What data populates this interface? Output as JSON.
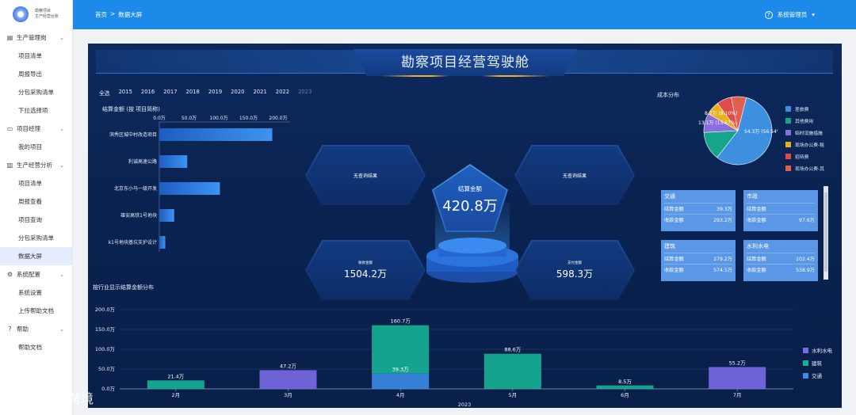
{
  "app": {
    "logo_line1": "勘察项目",
    "logo_line2": "生产经营台账"
  },
  "topbar": {
    "crumb_home": "首页",
    "crumb_sep": ">",
    "crumb_current": "数据大屏",
    "user_name": "系统管理员",
    "user_caret": "▾"
  },
  "sidebar": {
    "groups": [
      {
        "label": "生产管理岗",
        "icon": "building-icon",
        "items": [
          "项目清单",
          "周报导出",
          "分包采购清单",
          "下拉选择项"
        ]
      },
      {
        "label": "项目经理",
        "icon": "document-icon",
        "items": [
          "我的项目"
        ]
      },
      {
        "label": "生产经营分析",
        "icon": "chart-icon",
        "items": [
          "项目清单",
          "周报查看",
          "项目查询",
          "分包采购清单",
          "数据大屏"
        ]
      },
      {
        "label": "系统配置",
        "icon": "gear-icon",
        "items": [
          "系统设置",
          "上传帮助文档"
        ]
      },
      {
        "label": "帮助",
        "icon": "help-icon",
        "items": [
          "帮助文档"
        ]
      }
    ],
    "active": "数据大屏"
  },
  "dashboard": {
    "title": "勘察项目经营驾驶舱",
    "years": [
      "全选",
      "2015",
      "2016",
      "2017",
      "2018",
      "2019",
      "2020",
      "2021",
      "2022",
      "2023"
    ],
    "selected_year": "2023",
    "hex_top_left": "无查询结果",
    "hex_top_right": "无查询结果",
    "center_caption": "结算金额",
    "center_value": "420.8万",
    "hex_bottom_left_caption": "收款金额",
    "hex_bottom_left_value": "1504.2万",
    "hex_bottom_right_caption": "支付金额",
    "hex_bottom_right_value": "598.3万",
    "cost_title": "成本分布",
    "cost_legend": [
      {
        "label": "差旅费",
        "color": "#3d8fe0"
      },
      {
        "label": "其他费用",
        "color": "#16a58a"
      },
      {
        "label": "临时设施措施",
        "color": "#8a6de0"
      },
      {
        "label": "现场办公费-租",
        "color": "#e8b020"
      },
      {
        "label": "招待费",
        "color": "#e04b48"
      },
      {
        "label": "现场办公费-其",
        "color": "#e06050"
      }
    ],
    "cost_tables": [
      {
        "name": "交通",
        "settle_label": "结算金额",
        "settle": "39.3万",
        "collect_label": "收款金额",
        "collect": "293.2万"
      },
      {
        "name": "市政",
        "settle_label": "结算金额",
        "settle": "",
        "collect_label": "收款金额",
        "collect": "97.6万"
      },
      {
        "name": "建筑",
        "settle_label": "结算金额",
        "settle": "279.2万",
        "collect_label": "收款金额",
        "collect": "574.5万"
      },
      {
        "name": "水利水电",
        "settle_label": "结算金额",
        "settle": "102.4万",
        "collect_label": "收款金额",
        "collect": "538.9万"
      }
    ],
    "industry_title": "按行业显示结算金额分布"
  },
  "watermark": {
    "text": "大数跨境"
  },
  "chart_data": [
    {
      "type": "bar",
      "orientation": "horizontal",
      "title": "结算金额 (按 项目简称)",
      "categories": [
        "滨秀区城中村改造项目",
        "利诚高速公路",
        "北京东小马一级开发",
        "雄安高铁1号地块",
        "k1号地块基坑支护设计"
      ],
      "values": [
        190,
        47,
        102,
        25,
        10
      ],
      "ticks": [
        "0.0万",
        "50.0万",
        "100.0万",
        "150.0万",
        "200.0万"
      ],
      "xlim": [
        0,
        200
      ]
    },
    {
      "type": "pie",
      "title": "成本分布",
      "slices": [
        {
          "label": "差旅费",
          "value": 56.54,
          "text": "54.3万 (56.54%)",
          "color": "#3d8fe0"
        },
        {
          "label": "其他费用",
          "value": 13.67,
          "text": "13.1万 (13.67%)",
          "color": "#16a58a"
        },
        {
          "label": "临时设施措施",
          "value": 9.1,
          "text": "8.7万 (9.10%)",
          "color": "#8a6de0"
        },
        {
          "label": "现场办公费-租",
          "value": 6.5,
          "text": "",
          "color": "#e8b020"
        },
        {
          "label": "招待费",
          "value": 7.1,
          "text": "",
          "color": "#e04b48"
        },
        {
          "label": "现场办公费-其",
          "value": 7.09,
          "text": "",
          "color": "#e06050"
        }
      ]
    },
    {
      "type": "bar",
      "stacked": true,
      "title": "按行业显示结算金额分布",
      "categories": [
        "2月",
        "3月",
        "4月",
        "5月",
        "6月",
        "7月"
      ],
      "xlabel": "2023",
      "yticks": [
        "0.0万",
        "50.0万",
        "100.0万",
        "150.0万",
        "200.0万"
      ],
      "ylim": [
        0,
        200
      ],
      "series": [
        {
          "name": "交通",
          "color": "#3c8ce6",
          "values": [
            0,
            0,
            39.3,
            0,
            0,
            0
          ]
        },
        {
          "name": "建筑",
          "color": "#16b296",
          "values": [
            21.4,
            0,
            121.4,
            88.6,
            8.5,
            0
          ]
        },
        {
          "name": "水利水电",
          "color": "#7a6ae6",
          "values": [
            0,
            47.2,
            0,
            0,
            0,
            55.2
          ]
        }
      ],
      "bar_labels": [
        {
          "category": "2月",
          "text": "21.4万",
          "series": "建筑"
        },
        {
          "category": "3月",
          "text": "47.2万",
          "series": "水利水电"
        },
        {
          "category": "4月",
          "text": "160.7万",
          "series": "建筑"
        },
        {
          "category": "4月",
          "text": "39.3万",
          "series": "交通"
        },
        {
          "category": "5月",
          "text": "88.6万",
          "series": "建筑"
        },
        {
          "category": "6月",
          "text": "8.5万",
          "series": "建筑"
        },
        {
          "category": "7月",
          "text": "55.2万",
          "series": "水利水电"
        }
      ],
      "legend": [
        "水利水电",
        "建筑",
        "交通"
      ]
    }
  ]
}
